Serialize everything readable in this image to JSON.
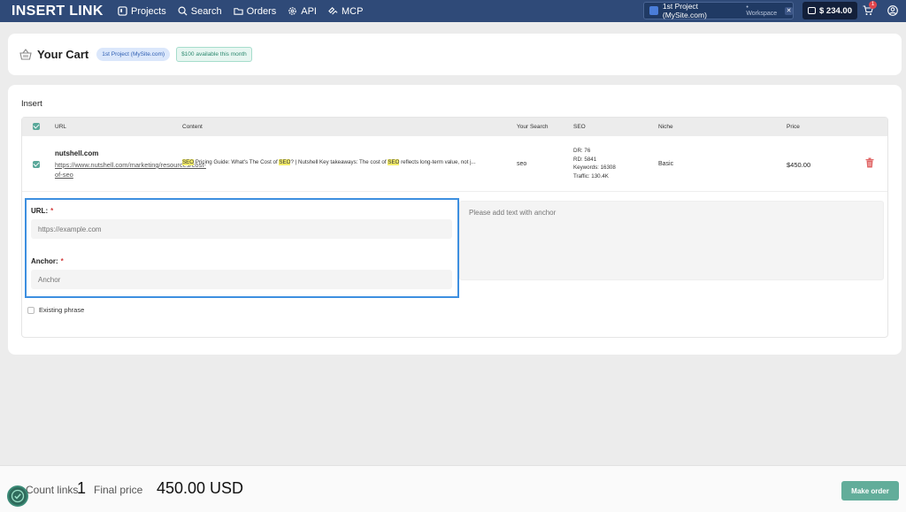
{
  "nav": {
    "logo": "INSERT LINK",
    "items": [
      {
        "label": "Projects",
        "icon": "projects-icon"
      },
      {
        "label": "Search",
        "icon": "search-icon"
      },
      {
        "label": "Orders",
        "icon": "folder-icon"
      },
      {
        "label": "API",
        "icon": "gear-icon"
      },
      {
        "label": "MCP",
        "icon": "mcp-icon"
      }
    ],
    "project_name": "1st Project (MySite.com)",
    "workspace": "• Workspace",
    "balance": "$ 234.00",
    "cart_count": "1"
  },
  "cart": {
    "title": "Your Cart",
    "project_badge": "1st Project (MySite.com)",
    "available_badge": "$100 available this month"
  },
  "main": {
    "section_title": "Insert",
    "columns": {
      "url": "URL",
      "content": "Content",
      "your_search": "Your Search",
      "seo": "SEO",
      "niche": "Niche",
      "price": "Price"
    },
    "rows": [
      {
        "site": "nutshell.com",
        "url": "https://www.nutshell.com/marketing/resources/cost-of-seo",
        "content_parts": [
          "SEO",
          " Pricing Guide: What's The Cost of ",
          "SEO",
          "? | Nutshell Key takeaways: The cost of ",
          "SEO",
          " reflects long-term value, not j..."
        ],
        "your_search": "seo",
        "dr": "DR: 76",
        "rd": "RD: 5841",
        "keywords": "Keywords: 16308",
        "traffic": "Traffic: 130.4K",
        "niche": "Basic",
        "price": "$450.00"
      }
    ],
    "form": {
      "url_label": "URL:",
      "url_placeholder": "https://example.com",
      "anchor_label": "Anchor:",
      "anchor_placeholder": "Anchor",
      "required_mark": "*",
      "text_placeholder": "Please add text with anchor",
      "existing_phrase": "Existing phrase"
    }
  },
  "footer": {
    "count_label": "Count links",
    "count_value": "1",
    "final_price_label": "Final price",
    "final_price_value": "450.00 USD",
    "make_order": "Make order"
  },
  "colors": {
    "nav_bg": "#2f4a78",
    "accent_green": "#62ad9a",
    "highlight": "#f3ec6b",
    "focus_border": "#3d8fe0"
  }
}
